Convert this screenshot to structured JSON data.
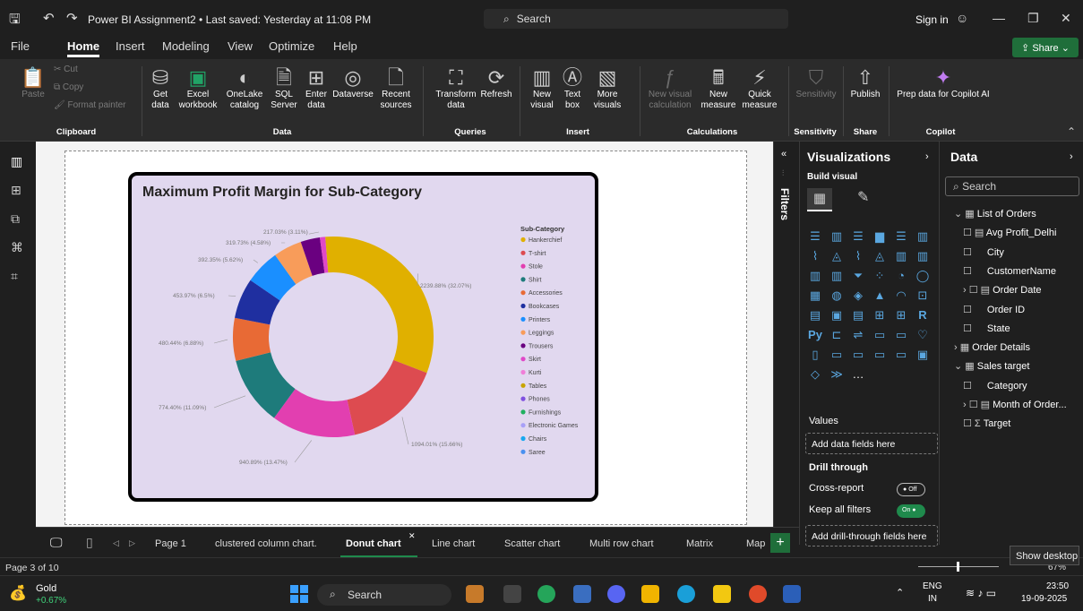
{
  "titlebar": {
    "title": "Power BI Assignment2 • Last saved: Yesterday at 11:08 PM",
    "search": "Search",
    "signin": "Sign in"
  },
  "menu": [
    "File",
    "Home",
    "Insert",
    "Modeling",
    "View",
    "Optimize",
    "Help"
  ],
  "share": "Share",
  "ribbon": {
    "paste": "Paste",
    "cut": "Cut",
    "copy": "Copy",
    "format_painter": "Format painter",
    "get_data": "Get data",
    "excel": "Excel workbook",
    "onelake": "OneLake catalog",
    "sql": "SQL Server",
    "enter_data": "Enter data",
    "dataverse": "Dataverse",
    "recent": "Recent sources",
    "transform": "Transform data",
    "refresh": "Refresh",
    "new_visual": "New visual",
    "text_box": "Text box",
    "more_visuals": "More visuals",
    "new_visual_calc": "New visual calculation",
    "new_measure": "New measure",
    "quick_measure": "Quick measure",
    "sensitivity": "Sensitivity",
    "publish": "Publish",
    "prep_copilot": "Prep data for Copilot AI",
    "groups": {
      "clipboard": "Clipboard",
      "data": "Data",
      "queries": "Queries",
      "insert": "Insert",
      "calculations": "Calculations",
      "sensitivity": "Sensitivity",
      "share": "Share",
      "copilot": "Copilot"
    }
  },
  "chart_data": {
    "type": "pie",
    "title": "Maximum Profit Margin for Sub-Category",
    "legend_title": "Sub-Category",
    "legend_position": "right",
    "categories": [
      "Hankerchief",
      "T-shirt",
      "Stole",
      "Shirt",
      "Accessories",
      "Bookcases",
      "Printers",
      "Leggings",
      "Trousers",
      "Skirt",
      "Kurti",
      "Tables",
      "Phones",
      "Furnishings",
      "Electronic Games",
      "Chairs",
      "Saree"
    ],
    "colors": [
      "#e0b000",
      "#dd4b50",
      "#e23fb0",
      "#1e7b7b",
      "#e86a35",
      "#1f2fa0",
      "#1a8fff",
      "#f89c5a",
      "#6a0080",
      "#e048c8",
      "#f07ed8",
      "#c8a400",
      "#8050e0",
      "#20b060",
      "#a8a0f8",
      "#18a8f0",
      "#4a90f0"
    ],
    "values": [
      2239.88,
      1094.01,
      940.89,
      774.4,
      480.44,
      453.97,
      392.35,
      319.73,
      217.03,
      60.0
    ],
    "labels": [
      "2239.88% (32.07%)",
      "1094.01% (15.66%)",
      "940.89% (13.47%)",
      "774.40% (11.09%)",
      "480.44% (6.88%)",
      "453.97% (6.5%)",
      "392.35% (5.62%)",
      "319.73% (4.58%)",
      "217.03% (3.11%)"
    ]
  },
  "filters": "Filters",
  "viz": {
    "title": "Visualizations",
    "build": "Build visual",
    "values": "Values",
    "add_fields": "Add data fields here",
    "drill": "Drill through",
    "cross_report": "Cross-report",
    "cross_state": "Off",
    "keep_filters": "Keep all filters",
    "keep_state": "On",
    "add_drill": "Add drill-through fields here"
  },
  "data_pane": {
    "title": "Data",
    "search": "Search",
    "items": [
      {
        "label": "List of Orders",
        "indent": 0,
        "prefix": "⌄ ▦"
      },
      {
        "label": "Avg Profit_Delhi",
        "indent": 1,
        "prefix": "☐ ▤"
      },
      {
        "label": "City",
        "indent": 1,
        "prefix": "☐"
      },
      {
        "label": "CustomerName",
        "indent": 1,
        "prefix": "☐"
      },
      {
        "label": "Order Date",
        "indent": 1,
        "prefix": "› ☐ ▤"
      },
      {
        "label": "Order ID",
        "indent": 1,
        "prefix": "☐"
      },
      {
        "label": "State",
        "indent": 1,
        "prefix": "☐"
      },
      {
        "label": "Order Details",
        "indent": 0,
        "prefix": "› ▦"
      },
      {
        "label": "Sales target",
        "indent": 0,
        "prefix": "⌄ ▦"
      },
      {
        "label": "Category",
        "indent": 1,
        "prefix": "☐"
      },
      {
        "label": "Month of Order...",
        "indent": 1,
        "prefix": "› ☐ ▤"
      },
      {
        "label": "Target",
        "indent": 1,
        "prefix": "☐ Σ"
      }
    ]
  },
  "tabs": [
    "Page 1",
    "clustered column chart.",
    "Donut chart",
    "Line chart",
    "Scatter chart",
    "Multi row chart",
    "Matrix",
    "Map"
  ],
  "status": {
    "page": "Page 3 of 10",
    "tooltip": "Show desktop",
    "zoom": "67%"
  },
  "taskbar": {
    "weather_name": "Gold",
    "weather_change": "+0.67%",
    "search": "Search",
    "lang": "ENG",
    "region": "IN",
    "time": "23:50",
    "date": "19-09-2025"
  }
}
